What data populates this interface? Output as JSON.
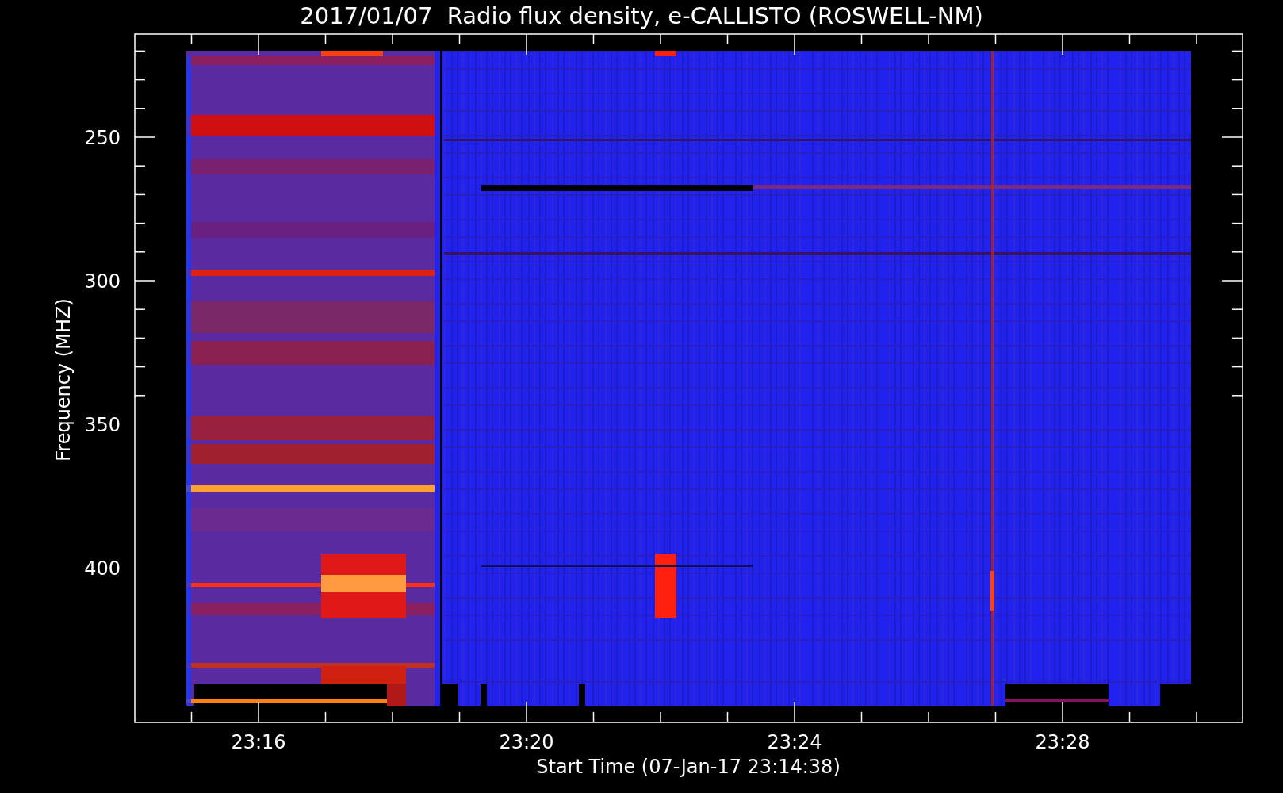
{
  "title": "2017/01/07  Radio flux density, e-CALLISTO (ROSWELL-NM)",
  "y_axis": {
    "label": "Frequency (MHZ)",
    "ticks": [
      "250",
      "300",
      "350",
      "400"
    ]
  },
  "x_axis": {
    "label": "Start Time (07-Jan-17 23:14:38)",
    "ticks": [
      "23:16",
      "23:20",
      "23:24",
      "23:28"
    ]
  }
}
